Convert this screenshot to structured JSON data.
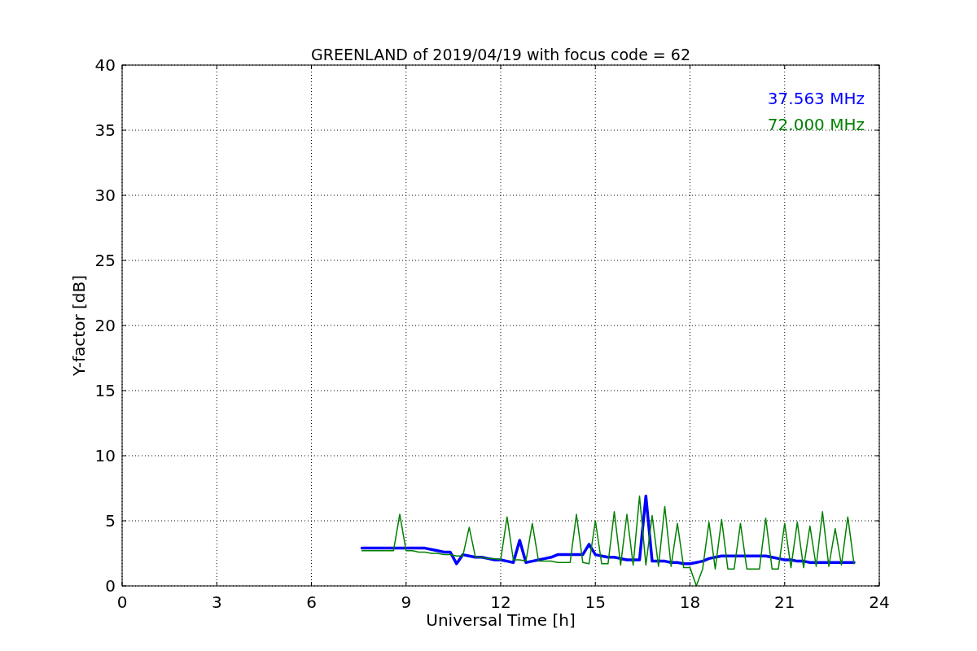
{
  "chart_data": {
    "type": "line",
    "title": "GREENLAND of 2019/04/19 with focus code = 62",
    "xlabel": "Universal Time [h]",
    "ylabel": "Y-factor [dB]",
    "xlim": [
      0,
      24
    ],
    "ylim": [
      0,
      40
    ],
    "xticks": [
      0,
      3,
      6,
      9,
      12,
      15,
      18,
      21,
      24
    ],
    "yticks": [
      0,
      5,
      10,
      15,
      20,
      25,
      30,
      35,
      40
    ],
    "grid": true,
    "x": [
      7.6,
      7.8,
      8.0,
      8.2,
      8.4,
      8.6,
      8.8,
      9.0,
      9.2,
      9.4,
      9.6,
      9.8,
      10.0,
      10.2,
      10.4,
      10.6,
      10.8,
      11.0,
      11.2,
      11.4,
      11.6,
      11.8,
      12.0,
      12.2,
      12.4,
      12.6,
      12.8,
      13.0,
      13.2,
      13.4,
      13.6,
      13.8,
      14.0,
      14.2,
      14.4,
      14.6,
      14.8,
      15.0,
      15.2,
      15.4,
      15.6,
      15.8,
      16.0,
      16.2,
      16.4,
      16.6,
      16.8,
      17.0,
      17.2,
      17.4,
      17.6,
      17.8,
      18.0,
      18.2,
      18.4,
      18.6,
      18.8,
      19.0,
      19.2,
      19.4,
      19.6,
      19.8,
      20.0,
      20.2,
      20.4,
      20.6,
      20.8,
      21.0,
      21.2,
      21.4,
      21.6,
      21.8,
      22.0,
      22.2,
      22.4,
      22.6,
      22.8,
      23.0,
      23.2
    ],
    "series": [
      {
        "name": "37.563 MHz",
        "color": "#0000ff",
        "values": [
          2.9,
          2.9,
          2.9,
          2.9,
          2.9,
          2.9,
          2.9,
          2.9,
          2.9,
          2.9,
          2.9,
          2.8,
          2.7,
          2.6,
          2.6,
          1.7,
          2.4,
          2.3,
          2.2,
          2.2,
          2.1,
          2.0,
          2.0,
          1.9,
          1.8,
          3.5,
          1.8,
          1.9,
          2.0,
          2.1,
          2.2,
          2.4,
          2.4,
          2.4,
          2.4,
          2.4,
          3.2,
          2.4,
          2.3,
          2.2,
          2.2,
          2.1,
          2.0,
          2.0,
          2.0,
          6.9,
          1.9,
          1.9,
          1.9,
          1.8,
          1.8,
          1.7,
          1.7,
          1.8,
          1.9,
          2.1,
          2.2,
          2.3,
          2.3,
          2.3,
          2.3,
          2.3,
          2.3,
          2.3,
          2.3,
          2.2,
          2.1,
          2.0,
          2.0,
          1.9,
          1.9,
          1.8,
          1.8,
          1.8,
          1.8,
          1.8,
          1.8,
          1.8,
          1.8
        ]
      },
      {
        "name": "72.000 MHz",
        "color": "#008000",
        "values": [
          2.7,
          2.7,
          2.7,
          2.7,
          2.7,
          2.7,
          5.5,
          2.7,
          2.7,
          2.6,
          2.6,
          2.5,
          2.5,
          2.4,
          2.4,
          2.3,
          2.3,
          4.5,
          2.2,
          2.2,
          2.1,
          2.1,
          2.0,
          5.3,
          2.0,
          2.0,
          1.9,
          4.8,
          1.9,
          1.9,
          1.9,
          1.8,
          1.8,
          1.8,
          5.5,
          1.8,
          1.7,
          5.0,
          1.7,
          1.7,
          5.7,
          1.6,
          5.5,
          1.6,
          6.9,
          1.6,
          5.4,
          1.5,
          6.1,
          1.5,
          4.8,
          1.4,
          1.4,
          0.0,
          1.3,
          4.9,
          1.3,
          5.1,
          1.3,
          1.3,
          4.8,
          1.3,
          1.3,
          1.3,
          5.2,
          1.3,
          1.3,
          4.8,
          1.4,
          4.9,
          1.4,
          4.6,
          1.5,
          5.7,
          1.5,
          4.4,
          1.6,
          5.3,
          1.7
        ]
      }
    ]
  }
}
